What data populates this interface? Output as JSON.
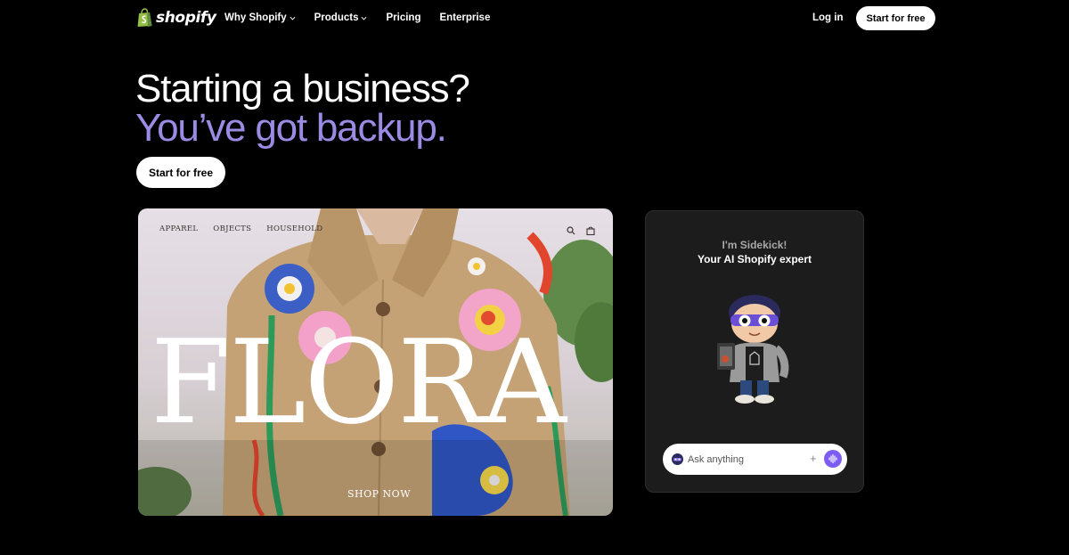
{
  "nav": {
    "logo_text": "shopify",
    "links": [
      "Why Shopify",
      "Products",
      "Pricing",
      "Enterprise"
    ],
    "login": "Log in",
    "cta": "Start for free"
  },
  "hero": {
    "line1": "Starting a business?",
    "line2": "You’ve got backup.",
    "cta": "Start for free",
    "accent_color": "#9b8be3"
  },
  "store_preview": {
    "nav_items": [
      "APPAREL",
      "OBJECTS",
      "HOUSEHOLD"
    ],
    "headline": "FLORA",
    "shop_link": "SHOP NOW",
    "icons": [
      "search-icon",
      "bag-icon"
    ]
  },
  "sidekick": {
    "intro": "I'm Sidekick!",
    "tagline": "Your AI Shopify expert",
    "input_placeholder": "Ask anything",
    "mic_color": "#7c5cf2"
  }
}
